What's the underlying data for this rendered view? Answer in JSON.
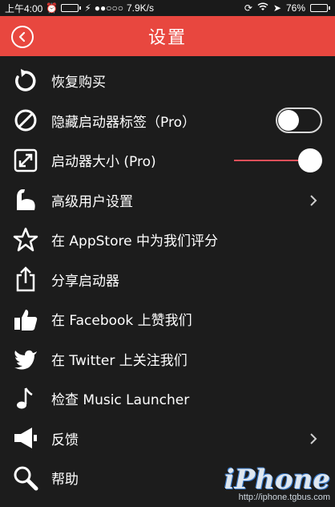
{
  "status_bar": {
    "time": "上午4:00",
    "network_speed": "7.9K/s",
    "battery_percent": "76%",
    "battery_fill_fraction": 0.76
  },
  "header": {
    "title": "设置",
    "back_icon": "back-chevron-circle-icon",
    "background_color": "#e8473f"
  },
  "settings": {
    "items": [
      {
        "label": "恢复购买",
        "icon": "restore-arrow-icon"
      },
      {
        "label": "隐藏启动器标签（Pro）",
        "icon": "hide-slash-icon",
        "control": "toggle",
        "toggle_on": false
      },
      {
        "label": "启动器大小 (Pro)",
        "icon": "resize-arrows-icon",
        "control": "slider",
        "slider_value": 1.0
      },
      {
        "label": "高级用户设置",
        "icon": "flexed-arm-icon",
        "control": "chevron"
      },
      {
        "label": "在 AppStore 中为我们评分",
        "icon": "star-icon"
      },
      {
        "label": "分享启动器",
        "icon": "share-icon"
      },
      {
        "label": "在 Facebook 上赞我们",
        "icon": "thumbs-up-icon"
      },
      {
        "label": "在 Twitter 上关注我们",
        "icon": "twitter-bird-icon"
      },
      {
        "label": "检查 Music Launcher",
        "icon": "music-note-icon"
      },
      {
        "label": "反馈",
        "icon": "megaphone-icon",
        "control": "chevron"
      },
      {
        "label": "帮助",
        "icon": "magnifier-icon"
      }
    ]
  },
  "watermark": {
    "brand": "iPhone",
    "subtitle": "http://iphone.tgbus.com"
  }
}
